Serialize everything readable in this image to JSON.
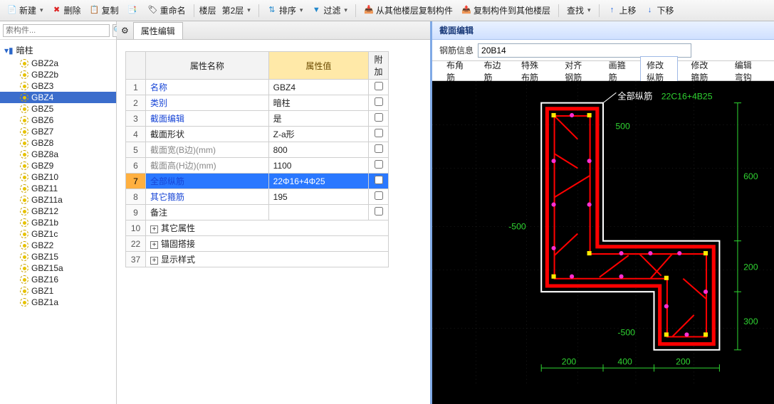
{
  "toolbar": {
    "new": "新建",
    "delete": "删除",
    "copy": "复制",
    "p2": "",
    "rename": "重命名",
    "layer_label": "楼层",
    "layer_value": "第2层",
    "sort": "排序",
    "filter": "过滤",
    "copy_from": "从其他楼层复制构件",
    "copy_to": "复制构件到其他楼层",
    "find": "查找",
    "up": "上移",
    "down": "下移"
  },
  "search": {
    "placeholder": "索构件..."
  },
  "tree": {
    "root": "暗柱",
    "items": [
      "GBZ2a",
      "GBZ2b",
      "GBZ3",
      "GBZ4",
      "GBZ5",
      "GBZ6",
      "GBZ7",
      "GBZ8",
      "GBZ8a",
      "GBZ9",
      "GBZ10",
      "GBZ11",
      "GBZ11a",
      "GBZ12",
      "GBZ1b",
      "GBZ1c",
      "GBZ2",
      "GBZ15",
      "GBZ15a",
      "GBZ16",
      "GBZ1",
      "GBZ1a"
    ],
    "selected_index": 3
  },
  "center_tab": "属性编辑",
  "prop_headers": {
    "name": "属性名称",
    "value": "属性值",
    "extra": "附加"
  },
  "props": [
    {
      "n": "1",
      "name": "名称",
      "value": "GBZ4",
      "chk": false,
      "link": true
    },
    {
      "n": "2",
      "name": "类别",
      "value": "暗柱",
      "chk": true,
      "link": true
    },
    {
      "n": "3",
      "name": "截面编辑",
      "value": "是",
      "chk": false,
      "link": true
    },
    {
      "n": "4",
      "name": "截面形状",
      "value": "Z-a形",
      "chk": true,
      "link": false
    },
    {
      "n": "5",
      "name": "截面宽(B边)(mm)",
      "value": "800",
      "chk": true,
      "link": false,
      "grey": true
    },
    {
      "n": "6",
      "name": "截面高(H边)(mm)",
      "value": "1100",
      "chk": true,
      "link": false,
      "grey": true
    },
    {
      "n": "7",
      "name": "全部纵筋",
      "value": "22Φ16+4Φ25",
      "chk": true,
      "link": true,
      "selected": true
    },
    {
      "n": "8",
      "name": "其它箍筋",
      "value": "195",
      "chk": false,
      "link": true
    },
    {
      "n": "9",
      "name": "备注",
      "value": "",
      "chk": true,
      "link": false
    },
    {
      "n": "10",
      "name": "其它属性",
      "value": "",
      "exp": true
    },
    {
      "n": "22",
      "name": "锚固搭接",
      "value": "",
      "exp": true
    },
    {
      "n": "37",
      "name": "显示样式",
      "value": "",
      "exp": true
    }
  ],
  "right": {
    "panel_title": "截面编辑",
    "rebar_label": "钢筋信息",
    "rebar_value": "20B14",
    "tabs": [
      "布角筋",
      "布边筋",
      "特殊布筋",
      "对齐钢筋",
      "画箍筋",
      "修改纵筋",
      "修改箍筋",
      "编辑弯钩"
    ],
    "tabs_active": 5,
    "callout_label": "全部纵筋",
    "callout_value": "22C16+4B25",
    "dims": {
      "top": "500",
      "left": "-500",
      "right1": "600",
      "right2": "200",
      "right3": "300",
      "bot_a": "200",
      "bot_b": "400",
      "bot_c": "200",
      "bot_axis": "-500"
    }
  }
}
